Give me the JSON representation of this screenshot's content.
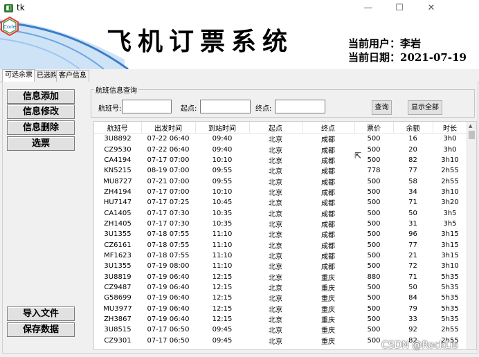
{
  "window": {
    "title": "tk",
    "min": "—",
    "max": "☐",
    "close": "✕"
  },
  "banner": {
    "title": "飞机订票系统",
    "user_line": "当前用户：李岩",
    "date_line": "当前日期：2021-07-19",
    "logo_text": "Code"
  },
  "tabs": [
    "可选余票",
    "已选购",
    "客户信息"
  ],
  "side_buttons": [
    "信息添加",
    "信息修改",
    "信息删除",
    "选票"
  ],
  "bottom_buttons": [
    "导入文件",
    "保存数据"
  ],
  "search": {
    "group_label": "航班信息查询",
    "flight_label": "航班号:",
    "origin_label": "起点:",
    "dest_label": "终点:",
    "flight_value": "",
    "origin_value": "",
    "dest_value": "",
    "query_button": "查询",
    "show_all_button": "显示全部"
  },
  "table": {
    "columns": [
      "航班号",
      "出发时间",
      "到站时间",
      "起点",
      "终点",
      "票价",
      "余额",
      "时长"
    ],
    "rows": [
      [
        "3U8892",
        "07-22 06:40",
        "09:40",
        "北京",
        "成都",
        "500",
        "16",
        "3h0"
      ],
      [
        "CZ9530",
        "07-22 06:40",
        "09:40",
        "北京",
        "成都",
        "500",
        "20",
        "3h0"
      ],
      [
        "CA4194",
        "07-17 07:00",
        "10:10",
        "北京",
        "成都",
        "500",
        "82",
        "3h10"
      ],
      [
        "KN5215",
        "08-19 07:00",
        "09:55",
        "北京",
        "成都",
        "778",
        "77",
        "2h55"
      ],
      [
        "MU8727",
        "07-21 07:00",
        "09:55",
        "北京",
        "成都",
        "500",
        "58",
        "2h55"
      ],
      [
        "ZH4194",
        "07-17 07:00",
        "10:10",
        "北京",
        "成都",
        "500",
        "34",
        "3h10"
      ],
      [
        "HU7147",
        "07-17 07:25",
        "10:45",
        "北京",
        "成都",
        "500",
        "71",
        "3h20"
      ],
      [
        "CA1405",
        "07-17 07:30",
        "10:35",
        "北京",
        "成都",
        "500",
        "50",
        "3h5"
      ],
      [
        "ZH1405",
        "07-17 07:30",
        "10:35",
        "北京",
        "成都",
        "500",
        "31",
        "3h5"
      ],
      [
        "3U1355",
        "07-18 07:55",
        "11:10",
        "北京",
        "成都",
        "500",
        "96",
        "3h15"
      ],
      [
        "CZ6161",
        "07-18 07:55",
        "11:10",
        "北京",
        "成都",
        "500",
        "77",
        "3h15"
      ],
      [
        "MF1623",
        "07-18 07:55",
        "11:10",
        "北京",
        "成都",
        "500",
        "21",
        "3h15"
      ],
      [
        "3U1355",
        "07-19 08:00",
        "11:10",
        "北京",
        "成都",
        "500",
        "72",
        "3h10"
      ],
      [
        "3U8819",
        "07-19 06:40",
        "12:15",
        "北京",
        "重庆",
        "880",
        "71",
        "5h35"
      ],
      [
        "CZ9487",
        "07-19 06:40",
        "12:15",
        "北京",
        "重庆",
        "500",
        "50",
        "5h35"
      ],
      [
        "G58699",
        "07-19 06:40",
        "12:15",
        "北京",
        "重庆",
        "500",
        "84",
        "5h35"
      ],
      [
        "MU3977",
        "07-19 06:40",
        "12:15",
        "北京",
        "重庆",
        "500",
        "79",
        "5h35"
      ],
      [
        "ZH3867",
        "07-19 06:40",
        "12:15",
        "北京",
        "重庆",
        "500",
        "33",
        "5h35"
      ],
      [
        "3U8515",
        "07-17 06:50",
        "09:45",
        "北京",
        "重庆",
        "500",
        "92",
        "2h55"
      ],
      [
        "CZ9301",
        "07-17 06:50",
        "09:45",
        "北京",
        "重庆",
        "500",
        "82",
        "2h55"
      ]
    ]
  },
  "watermark": "CSDN @RockLis",
  "colors": {
    "banner_blue": "#3a7dc9",
    "banner_light": "#cfe3f7"
  }
}
